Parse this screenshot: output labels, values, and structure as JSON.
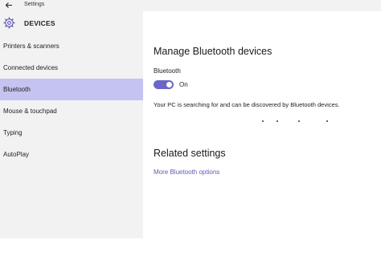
{
  "window": {
    "title": "Settings"
  },
  "header": {
    "title": "DEVICES"
  },
  "sidebar": {
    "items": [
      {
        "label": "Printers & scanners"
      },
      {
        "label": "Connected devices"
      },
      {
        "label": "Bluetooth"
      },
      {
        "label": "Mouse & touchpad"
      },
      {
        "label": "Typing"
      },
      {
        "label": "AutoPlay"
      }
    ],
    "active": "Bluetooth"
  },
  "main": {
    "manage_title": "Manage Bluetooth devices",
    "bluetooth_label": "Bluetooth",
    "toggle_state": "On",
    "toggle_on": true,
    "description": "Your PC is searching for and can be discovered by Bluetooth devices.",
    "related_title": "Related settings",
    "more_link": "More Bluetooth options"
  },
  "colors": {
    "accent": "#6b67c4",
    "active_item_bg": "#c5c3ef",
    "sidebar_bg": "#f2f2f2",
    "link": "#5f5bb6"
  },
  "icons": {
    "back": "back-arrow-icon",
    "settings": "gear-icon"
  }
}
